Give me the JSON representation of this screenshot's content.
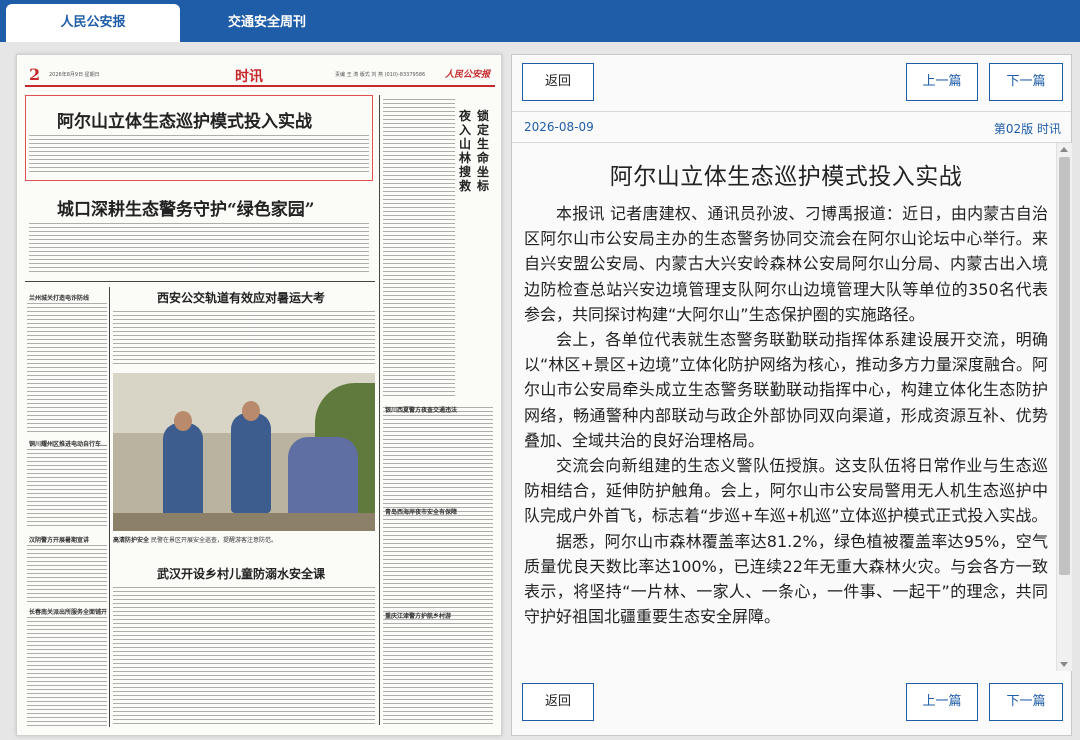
{
  "tabs": [
    {
      "label": "人民公安报",
      "active": true
    },
    {
      "label": "交通安全周刊",
      "active": false
    }
  ],
  "newspaper": {
    "page_number": "2",
    "date_line": "2026年8月9日 星期日",
    "section": "时讯",
    "header_meta": "责编 王 涛 版式 刘 燕 (010)-83379586",
    "logo": "人民公安报",
    "headline_1": "阿尔山立体生态巡护模式投入实战",
    "headline_2": "城口深耕生态警务守护“绿色家园”",
    "headline_3": "西安公交轨道有效应对暑运大考",
    "headline_4": "武汉开设乡村儿童防溺水安全课",
    "side_headline_1": "夜入山林搜救",
    "side_headline_2": "锁定生命坐标",
    "photo_caption": "民警在景区开展安全巡查，提醒游客注意防范。",
    "caption_tag": "高清防护安全",
    "small_titles": [
      "兰州城关打造电诈防线",
      "铜川耀州区推进电动自行车…",
      "汉阴警方开展暑期宣讲",
      "长春南关派出所服务全面铺开",
      "银川西夏警方夜查交通违法",
      "青岛西海岸夜市安全有保障",
      "重庆江津警方护航乡村游"
    ]
  },
  "article": {
    "date": "2026-08-09",
    "page_info": "第02版 时讯",
    "title": "阿尔山立体生态巡护模式投入实战",
    "paragraphs": [
      "本报讯 记者唐建权、通讯员孙波、刁博禹报道：近日，由内蒙古自治区阿尔山市公安局主办的生态警务协同交流会在阿尔山论坛中心举行。来自兴安盟公安局、内蒙古大兴安岭森林公安局阿尔山分局、内蒙古出入境边防检查总站兴安边境管理支队阿尔山边境管理大队等单位的350名代表参会，共同探讨构建“大阿尔山”生态保护圈的实施路径。",
      "会上，各单位代表就生态警务联勤联动指挥体系建设展开交流，明确以“林区+景区+边境”立体化防护网络为核心，推动多方力量深度融合。阿尔山市公安局牵头成立生态警务联勤联动指挥中心，构建立体化生态防护网络，畅通警种内部联动与政企外部协同双向渠道，形成资源互补、优势叠加、全域共治的良好治理格局。",
      "交流会向新组建的生态义警队伍授旗。这支队伍将日常作业与生态巡防相结合，延伸防护触角。会上，阿尔山市公安局警用无人机生态巡护中队完成户外首飞，标志着“步巡+车巡+机巡”立体巡护模式正式投入实战。",
      "据悉，阿尔山市森林覆盖率达81.2%，绿色植被覆盖率达95%，空气质量优良天数比率达100%，已连续22年无重大森林火灾。与会各方一致表示，将坚持“一片林、一家人、一条心，一件事、一起干”的理念，共同守护好祖国北疆重要生态安全屏障。"
    ]
  },
  "buttons": {
    "back": "返回",
    "prev": "上一篇",
    "next": "下一篇"
  },
  "colors": {
    "tab_bar": "#1f5da8",
    "accent_red": "#c6282b",
    "link_blue": "#1f5da8"
  }
}
